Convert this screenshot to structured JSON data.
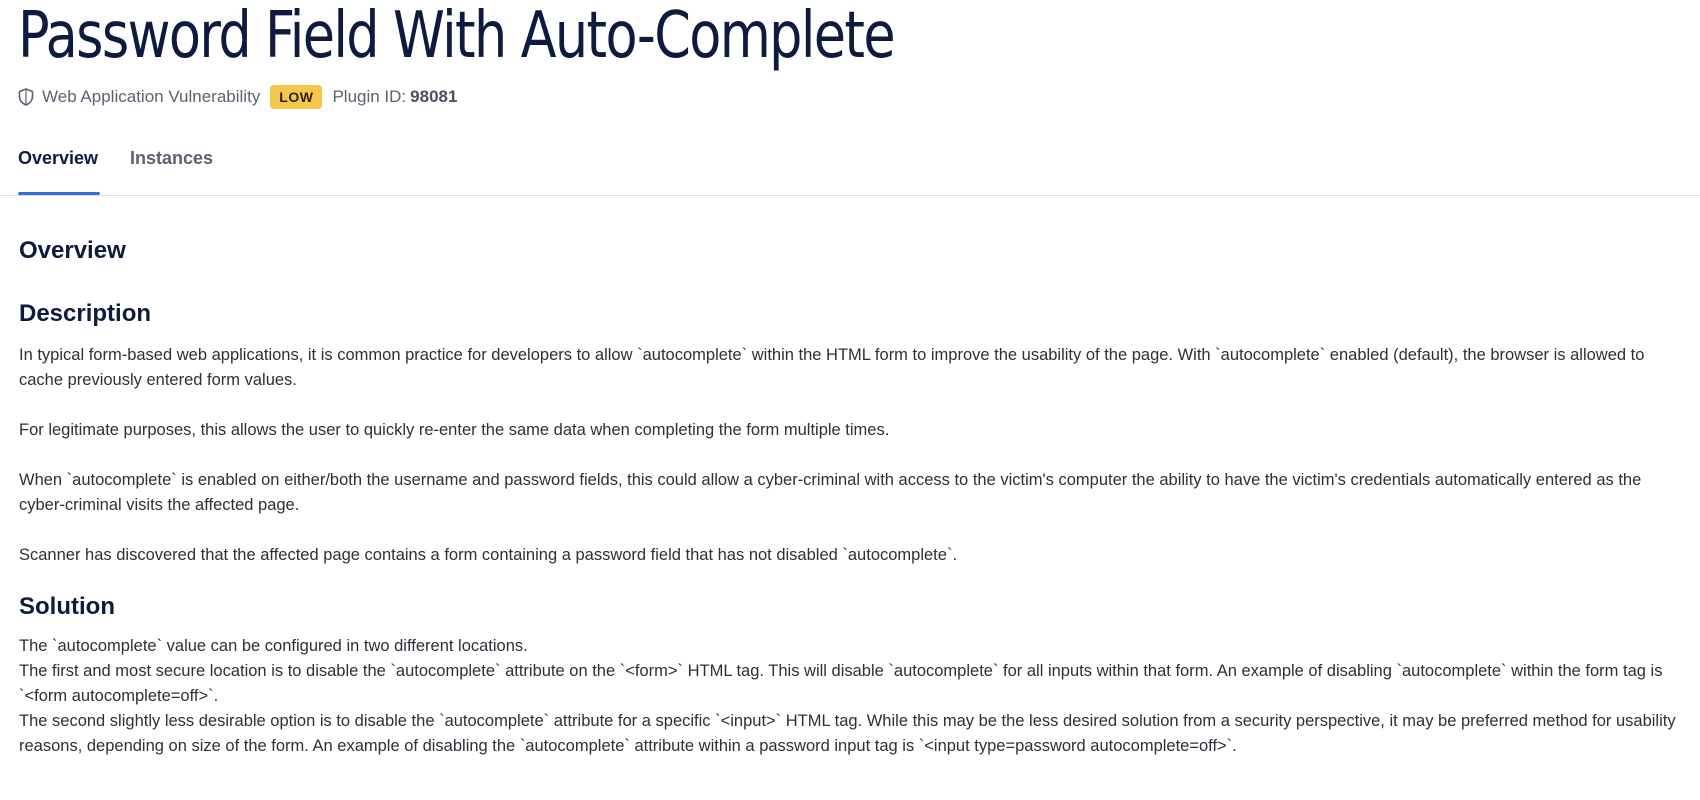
{
  "header": {
    "title": "Password Field With Auto-Complete",
    "category": "Web Application Vulnerability",
    "category_icon": "shield-icon",
    "severity": "LOW",
    "severity_color": "#f5c64b",
    "plugin_label": "Plugin ID:",
    "plugin_id": "98081"
  },
  "tabs": [
    {
      "label": "Overview",
      "active": true
    },
    {
      "label": "Instances",
      "active": false
    }
  ],
  "accent_color": "#2f6fdc",
  "content": {
    "overview_heading": "Overview",
    "description_heading": "Description",
    "description_paragraphs": [
      "In typical form-based web applications, it is common practice for developers to allow `autocomplete` within the HTML form to improve the usability of the page. With `autocomplete` enabled (default), the browser is allowed to cache previously entered form values.",
      "For legitimate purposes, this allows the user to quickly re-enter the same data when completing the form multiple times.",
      "When `autocomplete` is enabled on either/both the username and password fields, this could allow a cyber-criminal with access to the victim's computer the ability to have the victim's credentials automatically entered as the cyber-criminal visits the affected page.",
      "Scanner has discovered that the affected page contains a form containing a password field that has not disabled `autocomplete`."
    ],
    "solution_heading": "Solution",
    "solution_lines": [
      "The `autocomplete` value can be configured in two different locations.",
      "The first and most secure location is to disable the `autocomplete` attribute on the `<form>` HTML tag. This will disable `autocomplete` for all inputs within that form. An example of disabling `autocomplete` within the form tag is `<form autocomplete=off>`.",
      "The second slightly less desirable option is to disable the `autocomplete` attribute for a specific `<input>` HTML tag. While this may be the less desired solution from a security perspective, it may be preferred method for usability reasons, depending on size of the form. An example of disabling the `autocomplete` attribute within a password input tag is `<input type=password autocomplete=off>`."
    ]
  }
}
